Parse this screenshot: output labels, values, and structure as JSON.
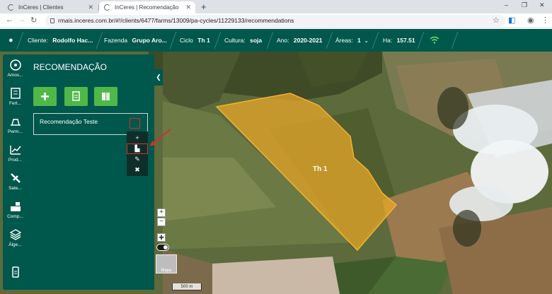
{
  "browser": {
    "tabs": [
      {
        "title": "InCeres | Clientes"
      },
      {
        "title": "InCeres | Recomendação"
      }
    ],
    "new_tab": "+",
    "url": "rmais.inceres.com.br/#!/clients/6477/farms/13009/pa-cycles/11229133/recommendations",
    "window_controls": {
      "minimize": "–",
      "maximize": "❐",
      "close": "✕"
    }
  },
  "header": {
    "cliente_label": "Cliente:",
    "cliente_value": "Rodolfo Hac...",
    "fazenda_label": "Fazenda",
    "fazenda_value": "Grupo Aro...",
    "ciclo_label": "Ciclo",
    "ciclo_value": "Th 1",
    "cultura_label": "Cultura:",
    "cultura_value": "soja",
    "ano_label": "Ano:",
    "ano_value": "2020-2021",
    "areas_label": "Áreas:",
    "areas_value": "1",
    "ha_label": "Ha:",
    "ha_value": "157.51"
  },
  "sidebar": {
    "items": [
      {
        "label": "Amos...",
        "icon": "sampling-icon"
      },
      {
        "label": "Fert...",
        "icon": "fertility-icon"
      },
      {
        "label": "Perm...",
        "icon": "permission-icon"
      },
      {
        "label": "Prod...",
        "icon": "productivity-icon"
      },
      {
        "label": "Sate...",
        "icon": "satellite-icon"
      },
      {
        "label": "Comp...",
        "icon": "composition-icon"
      },
      {
        "label": "Álge...",
        "icon": "layers-icon"
      },
      {
        "label": "",
        "icon": "mobile-icon"
      }
    ]
  },
  "panel": {
    "title": "RECOMENDAÇÃO",
    "recommendation_name": "Recomendação Teste",
    "dropdown": [
      "+",
      "▙",
      "✎",
      "✖"
    ]
  },
  "map": {
    "field_label": "Th 1",
    "scale": "500 m",
    "thumbnail_label": "Mapa",
    "zoom_in": "+",
    "zoom_out": "−",
    "field_color": "#e8a82a"
  }
}
